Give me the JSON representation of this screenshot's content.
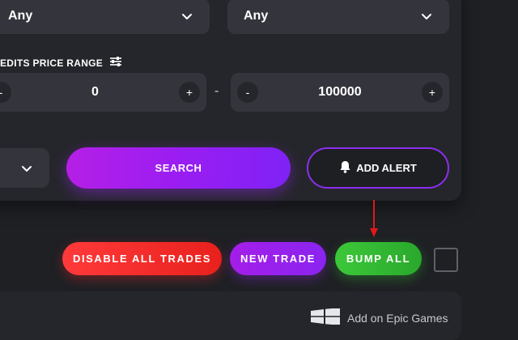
{
  "filters": {
    "select_left_value": "Any",
    "select_right_value": "Any"
  },
  "price_range": {
    "label": "EDITS PRICE RANGE",
    "min_value": "0",
    "max_value": "100000",
    "minus_symbol": "-",
    "plus_symbol": "+",
    "separator": "-"
  },
  "actions": {
    "search_label": "SEARCH",
    "add_alert_label": "ADD ALERT"
  },
  "trade_buttons": {
    "disable_all_label": "DISABLE ALL TRADES",
    "new_trade_label": "NEW TRADE",
    "bump_all_label": "BUMP ALL"
  },
  "bottom": {
    "epic_label": "Add on Epic Games"
  },
  "icons": {
    "chevron": "chevron-down-icon",
    "sliders": "sliders-icon",
    "bell": "bell-icon",
    "windows": "windows-icon",
    "arrow": "red-arrow-annotation"
  },
  "colors": {
    "background": "#1f2024",
    "panel": "#25262b",
    "input": "#34353c",
    "accent_purple": "#9a1df2",
    "red": "#ff3a3a",
    "green": "#3cc83a",
    "annotation_arrow": "#e01919"
  }
}
